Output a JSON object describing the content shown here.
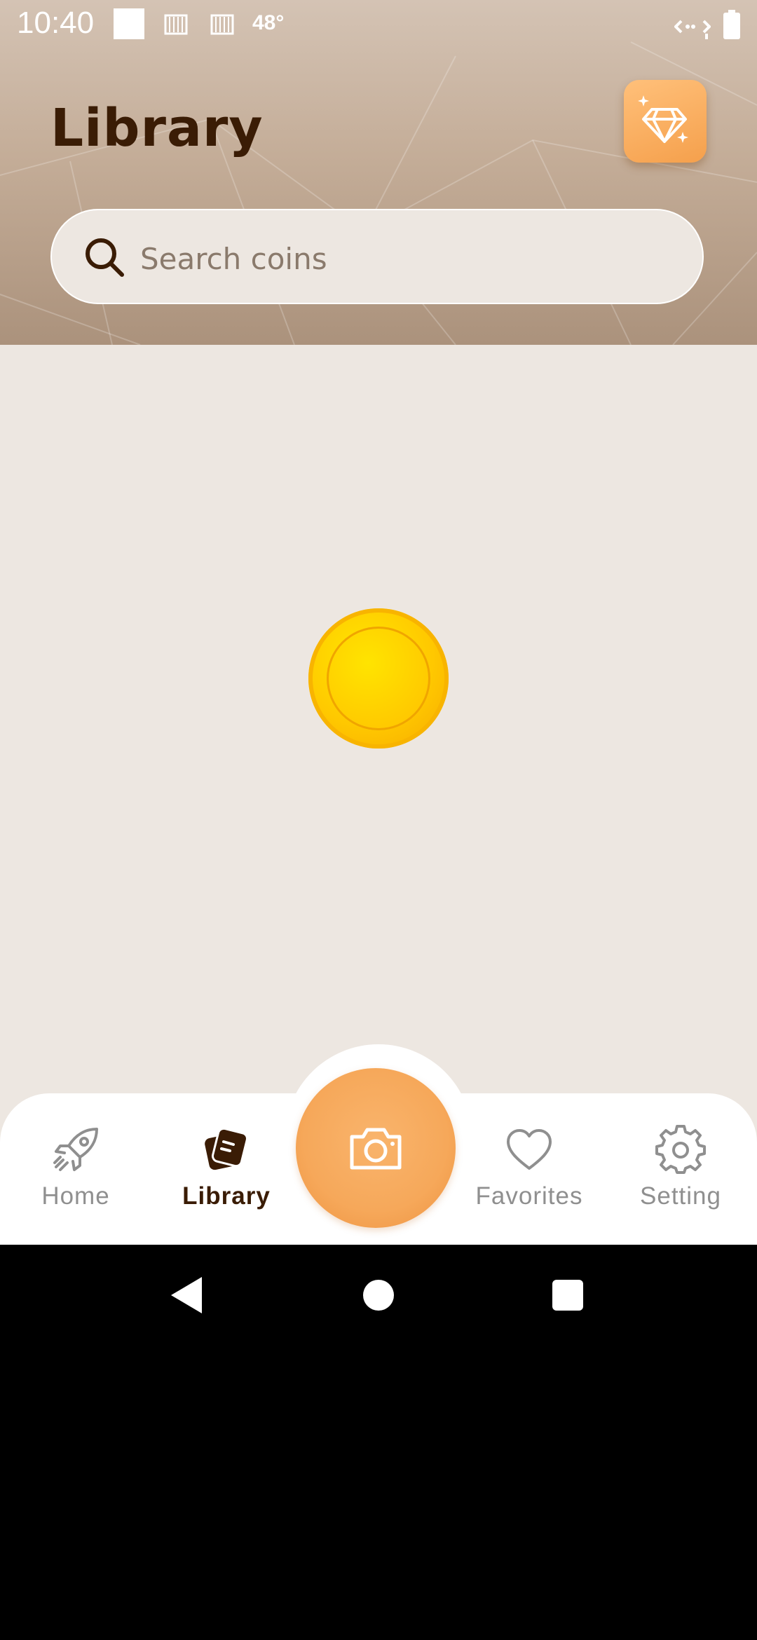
{
  "status_bar": {
    "time": "10:40",
    "temperature": "48°"
  },
  "header": {
    "title": "Library",
    "premium_icon": "diamond-sparkle-icon",
    "search": {
      "placeholder": "Search coins",
      "value": ""
    }
  },
  "content": {
    "loader": "spinning-coin"
  },
  "bottom_nav": {
    "items": [
      {
        "label": "Home",
        "icon": "rocket-icon",
        "active": false
      },
      {
        "label": "Library",
        "icon": "library-cards-icon",
        "active": true
      },
      {
        "label": "Favorites",
        "icon": "heart-icon",
        "active": false
      },
      {
        "label": "Setting",
        "icon": "gear-icon",
        "active": false
      }
    ],
    "center_action_icon": "camera-icon"
  },
  "colors": {
    "accent": "#f6a85a",
    "title": "#3a1c05",
    "background": "#ede7e1",
    "inactive": "#8f8f8f"
  }
}
